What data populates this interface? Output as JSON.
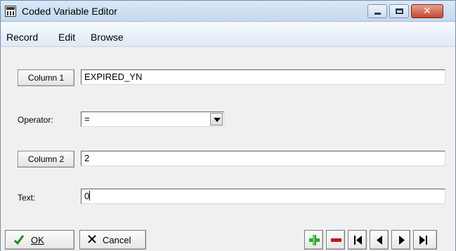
{
  "window": {
    "title": "Coded Variable Editor"
  },
  "menu": {
    "items": [
      "Record",
      "Edit",
      "Browse"
    ]
  },
  "form": {
    "column1": {
      "button_label": "Column 1",
      "value": "EXPIRED_YN"
    },
    "operator": {
      "label": "Operator:",
      "value": "="
    },
    "column2": {
      "button_label": "Column 2",
      "value": "2"
    },
    "text": {
      "label": "Text:",
      "value": "0"
    }
  },
  "toolbar": {
    "ok_label": "OK",
    "cancel_label": "Cancel",
    "icons": [
      "plus-icon",
      "minus-icon",
      "first-icon",
      "prev-icon",
      "next-icon",
      "last-icon"
    ]
  },
  "colors": {
    "plus": "#2ea82e",
    "minus": "#c01818",
    "titlebar": "#c4d8ee",
    "close": "#c5472f"
  }
}
